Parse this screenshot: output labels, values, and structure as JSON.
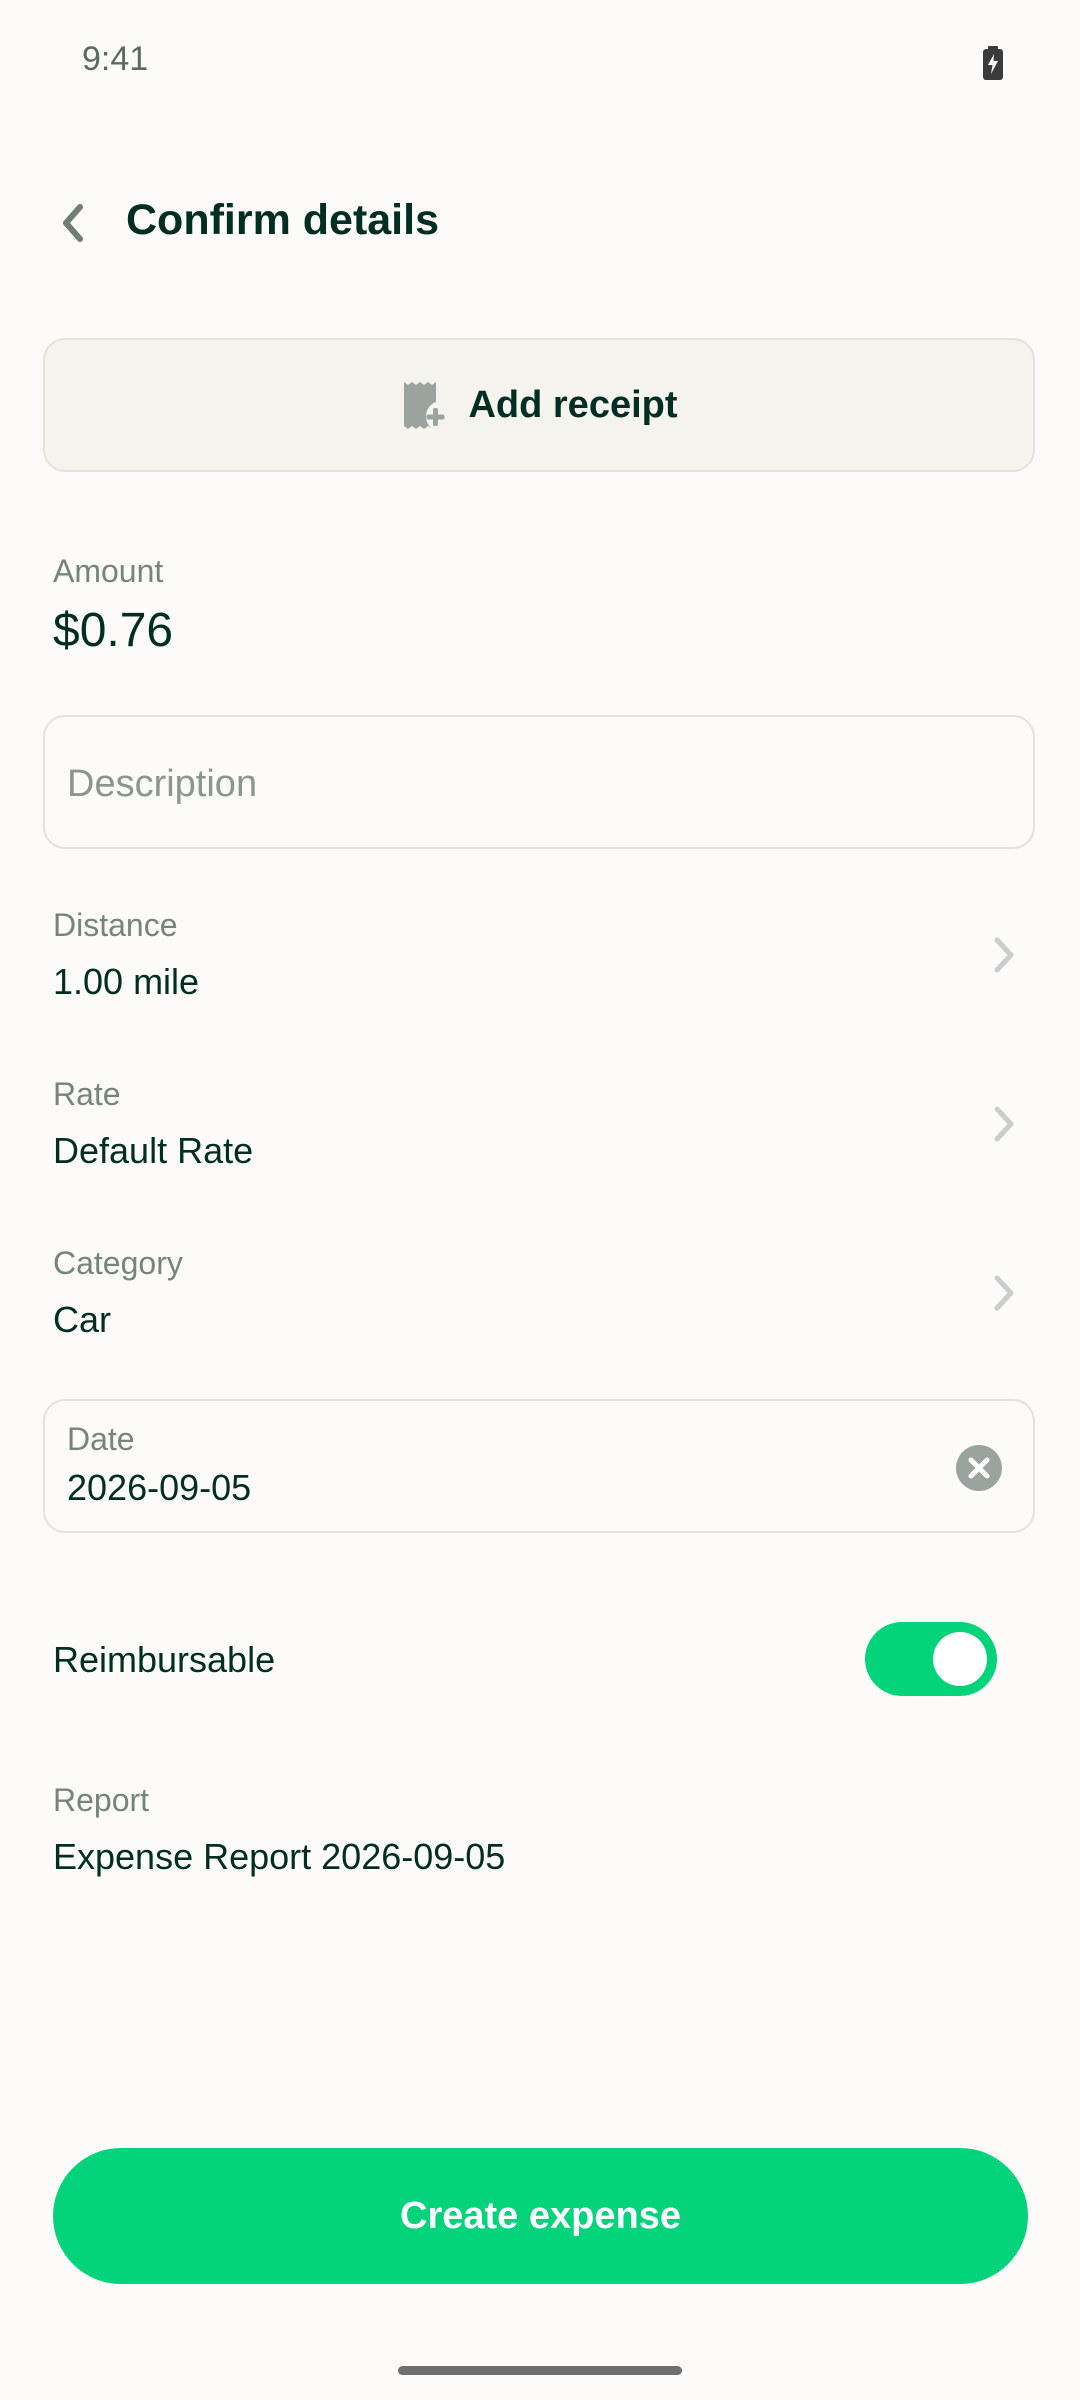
{
  "status_bar": {
    "time": "9:41"
  },
  "header": {
    "title": "Confirm details"
  },
  "receipt": {
    "label": "Add receipt"
  },
  "amount": {
    "label": "Amount",
    "value": "$0.76"
  },
  "description": {
    "placeholder": "Description"
  },
  "distance": {
    "label": "Distance",
    "value": "1.00 mile"
  },
  "rate": {
    "label": "Rate",
    "value": "Default Rate"
  },
  "category": {
    "label": "Category",
    "value": "Car"
  },
  "date": {
    "label": "Date",
    "value": "2026-09-05"
  },
  "reimbursable": {
    "label": "Reimbursable",
    "enabled": true
  },
  "report": {
    "label": "Report",
    "value": "Expense Report 2026-09-05"
  },
  "cta": {
    "label": "Create expense"
  },
  "colors": {
    "accent": "#03D47C",
    "text": "#002E22",
    "muted": "#76847E",
    "border": "#E6E1DA"
  },
  "icons": [
    "battery-icon",
    "back-arrow-icon",
    "receipt-add-icon",
    "chevron-right-icon",
    "clear-icon"
  ]
}
